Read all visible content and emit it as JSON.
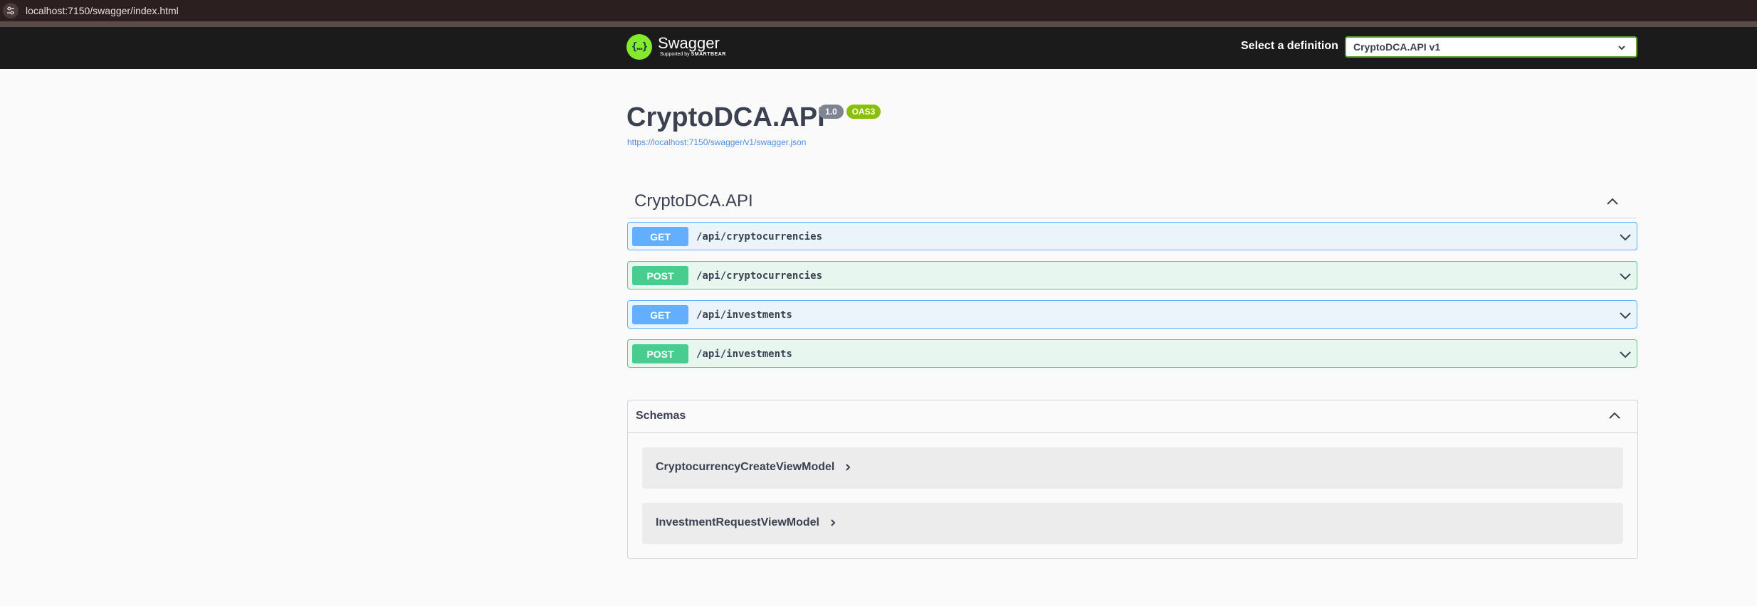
{
  "browser": {
    "url": "localhost:7150/swagger/index.html"
  },
  "topbar": {
    "logo_text": "Swagger",
    "logo_sub_prefix": "Supported by",
    "logo_sub_brand": "SMARTBEAR",
    "definition_label": "Select a definition",
    "definition_selected": "CryptoDCA.API v1"
  },
  "info": {
    "title": "CryptoDCA.API",
    "version": "1.0",
    "oas_badge": "OAS3",
    "spec_url": "https://localhost:7150/swagger/v1/swagger.json"
  },
  "tag": {
    "name": "CryptoDCA.API",
    "operations": [
      {
        "method": "GET",
        "path": "/api/cryptocurrencies"
      },
      {
        "method": "POST",
        "path": "/api/cryptocurrencies"
      },
      {
        "method": "GET",
        "path": "/api/investments"
      },
      {
        "method": "POST",
        "path": "/api/investments"
      }
    ]
  },
  "schemas": {
    "label": "Schemas",
    "models": [
      {
        "name": "CryptocurrencyCreateViewModel"
      },
      {
        "name": "InvestmentRequestViewModel"
      }
    ]
  },
  "colors": {
    "get": "#61affe",
    "post": "#49cc90",
    "topbar": "#1b1b1b",
    "accent": "#85ea2d"
  }
}
